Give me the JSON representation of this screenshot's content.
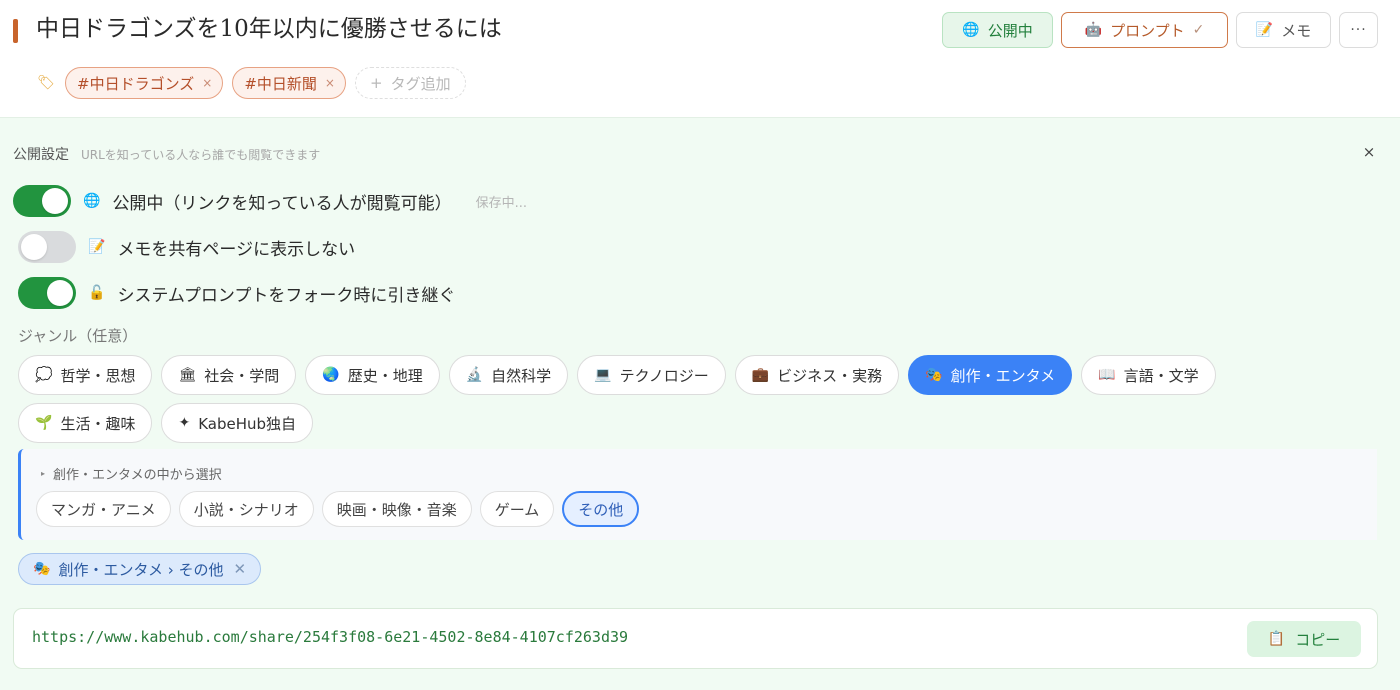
{
  "header": {
    "title": "中日ドラゴンズを10年以内に優勝させるには",
    "public_button": {
      "icon": "🌐",
      "label": "公開中"
    },
    "prompt_button": {
      "icon": "🤖",
      "label": "プロンプト",
      "check": "✓"
    },
    "memo_button": {
      "icon": "📝",
      "label": "メモ"
    },
    "more_button": {
      "label": "···"
    }
  },
  "tags": {
    "icon": "🏷",
    "items": [
      {
        "label": "#中日ドラゴンズ",
        "remove": "×"
      },
      {
        "label": "#中日新聞",
        "remove": "×"
      }
    ],
    "add_icon": "+",
    "add_label": "タグ追加"
  },
  "settings": {
    "title": "公開設定",
    "description": "URLを知っている人なら誰でも閲覧できます",
    "close": "×",
    "toggles": [
      {
        "state": "on",
        "icon": "🌐",
        "label": "公開中（リンクを知っている人が閲覧可能）",
        "status": "保存中..."
      },
      {
        "state": "off",
        "icon": "📝",
        "label": "メモを共有ページに表示しない"
      },
      {
        "state": "on",
        "icon": "🔓",
        "label": "システムプロンプトをフォーク時に引き継ぐ"
      }
    ]
  },
  "genre": {
    "label": "ジャンル（任意）",
    "items": [
      {
        "icon": "💭",
        "label": "哲学・思想"
      },
      {
        "icon": "🏛",
        "label": "社会・学問"
      },
      {
        "icon": "🌏",
        "label": "歴史・地理"
      },
      {
        "icon": "🔬",
        "label": "自然科学"
      },
      {
        "icon": "💻",
        "label": "テクノロジー"
      },
      {
        "icon": "💼",
        "label": "ビジネス・実務"
      },
      {
        "icon": "🎭",
        "label": "創作・エンタメ",
        "selected": true
      },
      {
        "icon": "📖",
        "label": "言語・文学"
      },
      {
        "icon": "🌱",
        "label": "生活・趣味"
      },
      {
        "icon": "✦",
        "label": "KabeHub独自"
      }
    ],
    "sub": {
      "title_icon": "▸",
      "title": "創作・エンタメの中から選択",
      "items": [
        {
          "label": "マンガ・アニメ"
        },
        {
          "label": "小説・シナリオ"
        },
        {
          "label": "映画・映像・音楽"
        },
        {
          "label": "ゲーム"
        },
        {
          "label": "その他",
          "selected": true
        }
      ]
    },
    "selection": {
      "icon": "🎭",
      "label": "創作・エンタメ › その他",
      "remove": "✕"
    }
  },
  "share": {
    "url": "https://www.kabehub.com/share/254f3f08-6e21-4502-8e84-4107cf263d39",
    "copy_icon": "📋",
    "copy_label": "コピー"
  },
  "colors": {
    "accent_green": "#22943f",
    "accent_blue": "#3b82f6",
    "tag_orange": "#b44f2a",
    "title_marker": "#c8642c"
  }
}
